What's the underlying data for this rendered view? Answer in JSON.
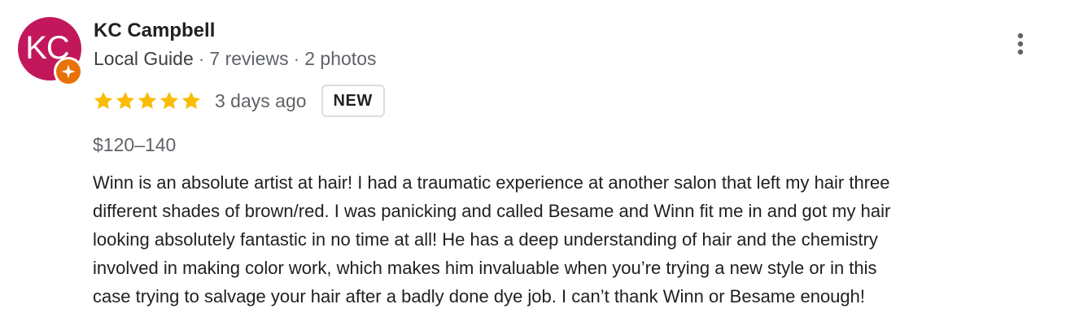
{
  "reviewer": {
    "initials": "KC",
    "name": "KC Campbell",
    "avatar_color": "#c2185b",
    "badge_icon": "local-guide-star-icon",
    "badge_color": "#e8710a",
    "role": "Local Guide",
    "reviews": "7 reviews",
    "photos": "2 photos",
    "separator": "·"
  },
  "menu": {
    "icon": "more-vert-icon"
  },
  "rating": {
    "stars": 5,
    "max_stars": 5,
    "star_color": "#fbbc04",
    "date": "3 days ago",
    "badge": "NEW"
  },
  "price": "$120–140",
  "review": {
    "lines": [
      "Winn is an absolute artist at hair! I had a traumatic experience at another salon that left my hair three",
      "different shades of brown/red. I was panicking and called Besame and Winn fit me in and got my hair",
      "looking absolutely fantastic in no time at all! He has a deep understanding of hair and the chemistry",
      "involved in making color work, which makes him invaluable when you’re trying a new style or in this",
      "case trying to salvage your hair after a badly done dye job. I can’t thank Winn or Besame enough!"
    ]
  }
}
